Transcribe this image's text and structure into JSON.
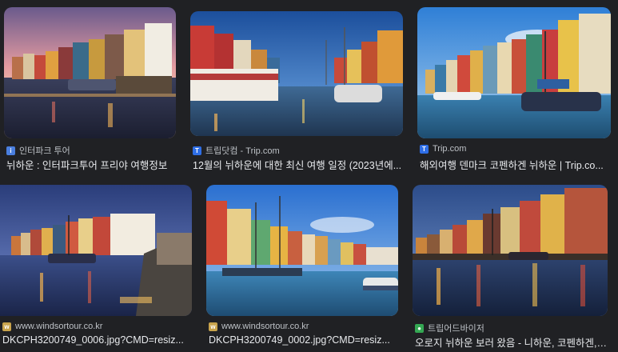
{
  "results": [
    {
      "source": "인터파크 투어",
      "title": "뉘하운 : 인터파크투어 프리야 여행정보",
      "favicon": "interpark-icon",
      "favicon_color": "#4a7fe0"
    },
    {
      "source": "트립닷컴 - Trip.com",
      "title": "12월의 뉘하운에 대한 최신 여행 일정 (2023년에...",
      "favicon": "trip-com-icon",
      "favicon_color": "#2e6ee6"
    },
    {
      "source": "Trip.com",
      "title": "해외여행 덴마크 코펜하겐 뉘하운 | Trip.co...",
      "favicon": "trip-com-icon",
      "favicon_color": "#2e6ee6"
    },
    {
      "source": "www.windsortour.co.kr",
      "title": "DKCPH3200749_0006.jpg?CMD=resiz...",
      "favicon": "windsortour-icon",
      "favicon_color": "#c9a44c"
    },
    {
      "source": "www.windsortour.co.kr",
      "title": "DKCPH3200749_0002.jpg?CMD=resiz...",
      "favicon": "windsortour-icon",
      "favicon_color": "#c9a44c"
    },
    {
      "source": "트립어드바이저",
      "title": "오로지 뉘하운 보러 왔음 - 니하운, 코펜하겐, ...",
      "favicon": "tripadvisor-icon",
      "favicon_color": "#34a853"
    }
  ]
}
